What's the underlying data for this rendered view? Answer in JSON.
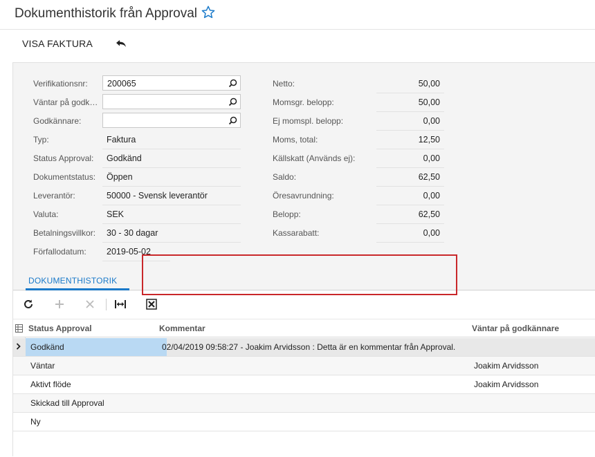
{
  "header": {
    "title": "Dokumenthistorik från Approval",
    "star_icon": "star-outline-icon",
    "accent": "#1979c9"
  },
  "toolbar": {
    "view_invoice": "VISA FAKTURA",
    "undo_icon": "undo-icon"
  },
  "form": {
    "left": [
      {
        "label": "Verifikationsnr:",
        "value": "200065",
        "kind": "lookup"
      },
      {
        "label": "Väntar på godk…",
        "value": "",
        "kind": "lookup"
      },
      {
        "label": "Godkännare:",
        "value": "",
        "kind": "lookup"
      },
      {
        "label": "Typ:",
        "value": "Faktura",
        "kind": "text"
      },
      {
        "label": "Status Approval:",
        "value": "Godkänd",
        "kind": "text"
      },
      {
        "label": "Dokumentstatus:",
        "value": "Öppen",
        "kind": "text"
      },
      {
        "label": "Leverantör:",
        "value": "50000 - Svensk leverantör",
        "kind": "text"
      },
      {
        "label": "Valuta:",
        "value": "SEK",
        "kind": "text"
      },
      {
        "label": "Betalningsvillkor:",
        "value": "30 - 30 dagar",
        "kind": "text"
      },
      {
        "label": "Förfallodatum:",
        "value": "2019-05-02",
        "kind": "text"
      }
    ],
    "right": [
      {
        "label": "Netto:",
        "value": "50,00"
      },
      {
        "label": "Momsgr. belopp:",
        "value": "50,00"
      },
      {
        "label": "Ej momspl. belopp:",
        "value": "0,00"
      },
      {
        "label": "Moms, total:",
        "value": "12,50"
      },
      {
        "label": "Källskatt (Används ej):",
        "value": "0,00"
      },
      {
        "label": "Saldo:",
        "value": "62,50"
      },
      {
        "label": "Öresavrundning:",
        "value": "0,00"
      },
      {
        "label": "Belopp:",
        "value": "62,50"
      },
      {
        "label": "Kassarabatt:",
        "value": "0,00"
      }
    ]
  },
  "tabs": [
    {
      "label": "DOKUMENTHISTORIK",
      "active": true
    }
  ],
  "grid": {
    "columns": [
      "Status Approval",
      "Kommentar",
      "Väntar på godkännare"
    ],
    "rows": [
      {
        "status": "Godkänd",
        "comment": "02/04/2019 09:58:27 - Joakim Arvidsson : Detta är en kommentar från Approval.",
        "waiting": ""
      },
      {
        "status": "Väntar",
        "comment": "",
        "waiting": "Joakim Arvidsson"
      },
      {
        "status": "Aktivt flöde",
        "comment": "",
        "waiting": "Joakim Arvidsson"
      },
      {
        "status": "Skickad till Approval",
        "comment": "",
        "waiting": ""
      },
      {
        "status": "Ny",
        "comment": "",
        "waiting": ""
      }
    ],
    "highlight_color": "#c9272a",
    "selection_color": "#b9d9f3"
  }
}
